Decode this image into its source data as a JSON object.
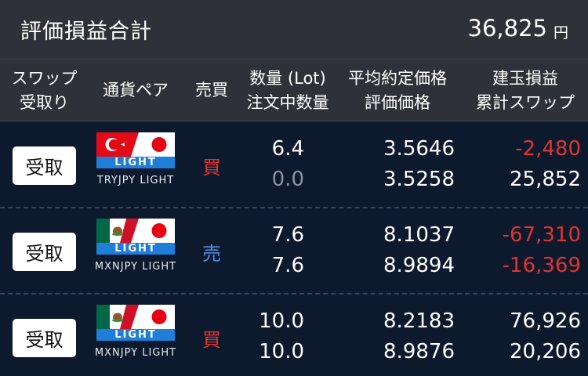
{
  "summary": {
    "label": "評価損益合計",
    "value": "36,825",
    "unit": "円"
  },
  "header": {
    "swap_line1": "スワップ",
    "swap_line2": "受取り",
    "pair": "通貨ペア",
    "side": "売買",
    "qty_line1": "数量 (Lot)",
    "qty_line2": "注文中数量",
    "price_line1": "平均約定価格",
    "price_line2": "評価価格",
    "pl_line1": "建玉損益",
    "pl_line2": "累計スワップ"
  },
  "colors": {
    "buy": "#e0332f",
    "sell": "#4e8ee2",
    "negative": "#e0332f",
    "background": "#0d1a2e",
    "header": "#2e3137",
    "light_band": "#1e7ed8"
  },
  "rows": [
    {
      "button": "受取",
      "flag_badge": "LIGHT",
      "flag_icon": "turkey-japan-flag-icon",
      "pair": "TRYJPY LIGHT",
      "side": "買",
      "qty": "6.4",
      "order_qty": "0.0",
      "avg_price": "3.5646",
      "eval_price": "3.5258",
      "position_pl": "-2,480",
      "swap": "25,852"
    },
    {
      "button": "受取",
      "flag_badge": "LIGHT",
      "flag_icon": "mexico-japan-flag-icon",
      "pair": "MXNJPY LIGHT",
      "side": "売",
      "qty": "7.6",
      "order_qty": "7.6",
      "avg_price": "8.1037",
      "eval_price": "8.9894",
      "position_pl": "-67,310",
      "swap": "-16,369"
    },
    {
      "button": "受取",
      "flag_badge": "LIGHT",
      "flag_icon": "mexico-japan-flag-icon",
      "pair": "MXNJPY LIGHT",
      "side": "買",
      "qty": "10.0",
      "order_qty": "10.0",
      "avg_price": "8.2183",
      "eval_price": "8.9876",
      "position_pl": "76,926",
      "swap": "20,206"
    }
  ]
}
